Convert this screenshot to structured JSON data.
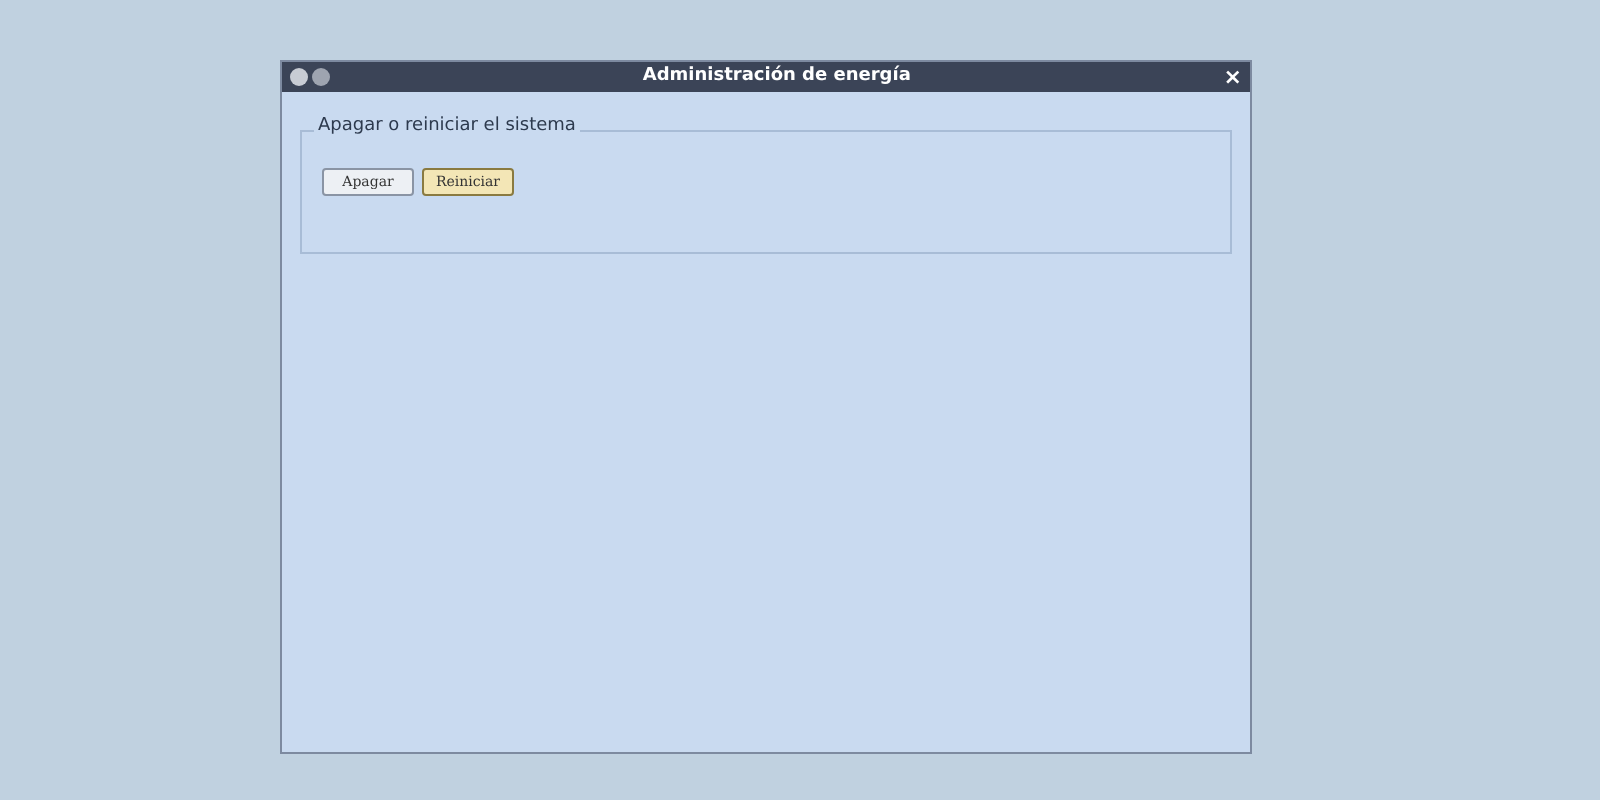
{
  "window": {
    "title": "Administración de energía",
    "close": "×"
  },
  "group": {
    "legend": "Apagar o reiniciar el sistema",
    "buttons": [
      {
        "label": "Apagar",
        "hovered": false
      },
      {
        "label": "Reiniciar",
        "hovered": true
      }
    ]
  }
}
